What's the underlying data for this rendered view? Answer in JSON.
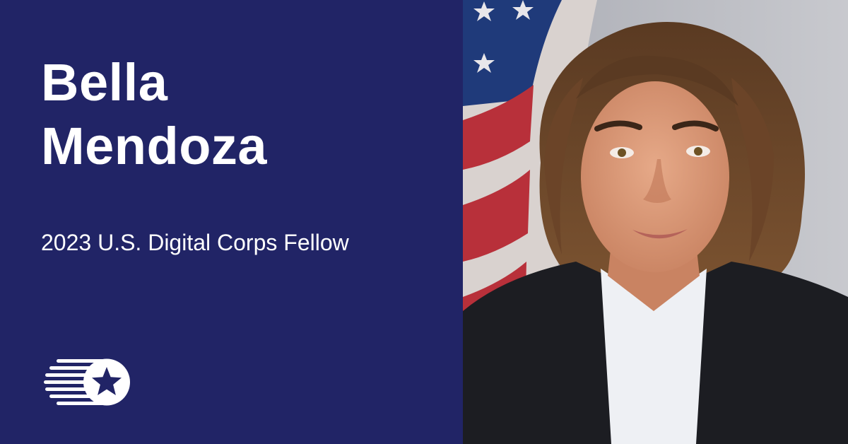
{
  "profile": {
    "name_line1": "Bella",
    "name_line2": "Mendoza",
    "title": "2023 U.S. Digital Corps Fellow"
  },
  "logo": {
    "icon": "digital-corps-star-logo-icon"
  },
  "photo": {
    "icon": "portrait-photo"
  },
  "colors": {
    "panel_background": "#212466",
    "text": "#ffffff",
    "flag_red": "#b8303a",
    "flag_blue": "#1f3a7a",
    "photo_background": "#b7b9bf"
  }
}
